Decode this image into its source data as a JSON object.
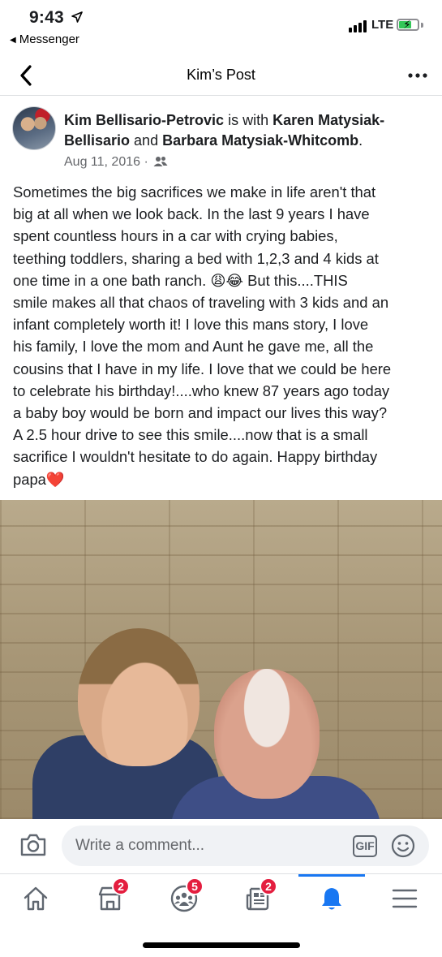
{
  "status_bar": {
    "time": "9:43",
    "back_app": "Messenger",
    "network": "LTE"
  },
  "nav": {
    "title": "Kim’s Post"
  },
  "post": {
    "author": "Kim Bellisario-Petrovic",
    "with_text": " is with ",
    "tagged_1": "Karen Matysiak-Bellisario",
    "and_text": " and ",
    "tagged_2": "Barbara Matysiak-Whitcomb",
    "period": ".",
    "date": "Aug 11, 2016 ·",
    "audience_icon": "friends-icon",
    "lines": [
      "Sometimes the big sacrifices we make in life aren't that",
      "big at all when we look back. In the last 9 years I have",
      "spent countless hours in a car with crying babies,",
      "teething toddlers, sharing a bed with 1,2,3 and 4 kids at",
      "one time  in a one bath ranch. 😩😂 But this....THIS",
      "smile makes all that chaos of traveling with 3 kids and an",
      "infant completely worth it! I love this mans story, I love",
      "his family, I love the mom and Aunt he gave me, all the",
      "cousins that I have in my life. I love that we could be here",
      "to celebrate his birthday!....who knew 87 years ago today",
      "a baby boy would be born and impact our lives this way?",
      "A 2.5 hour drive to see this smile....now that is a small",
      "sacrifice I wouldn't hesitate to do again. Happy birthday",
      "papa❤️"
    ]
  },
  "comment_bar": {
    "placeholder": "Write a comment...",
    "gif_label": "GIF"
  },
  "tabs": [
    {
      "name": "home",
      "badge": ""
    },
    {
      "name": "marketplace",
      "badge": "2"
    },
    {
      "name": "groups",
      "badge": "5"
    },
    {
      "name": "news",
      "badge": "2"
    },
    {
      "name": "notifications",
      "badge": ""
    },
    {
      "name": "menu",
      "badge": ""
    }
  ],
  "colors": {
    "accent": "#1877f2",
    "badge": "#e41e3f",
    "secondary_text": "#65676b"
  }
}
